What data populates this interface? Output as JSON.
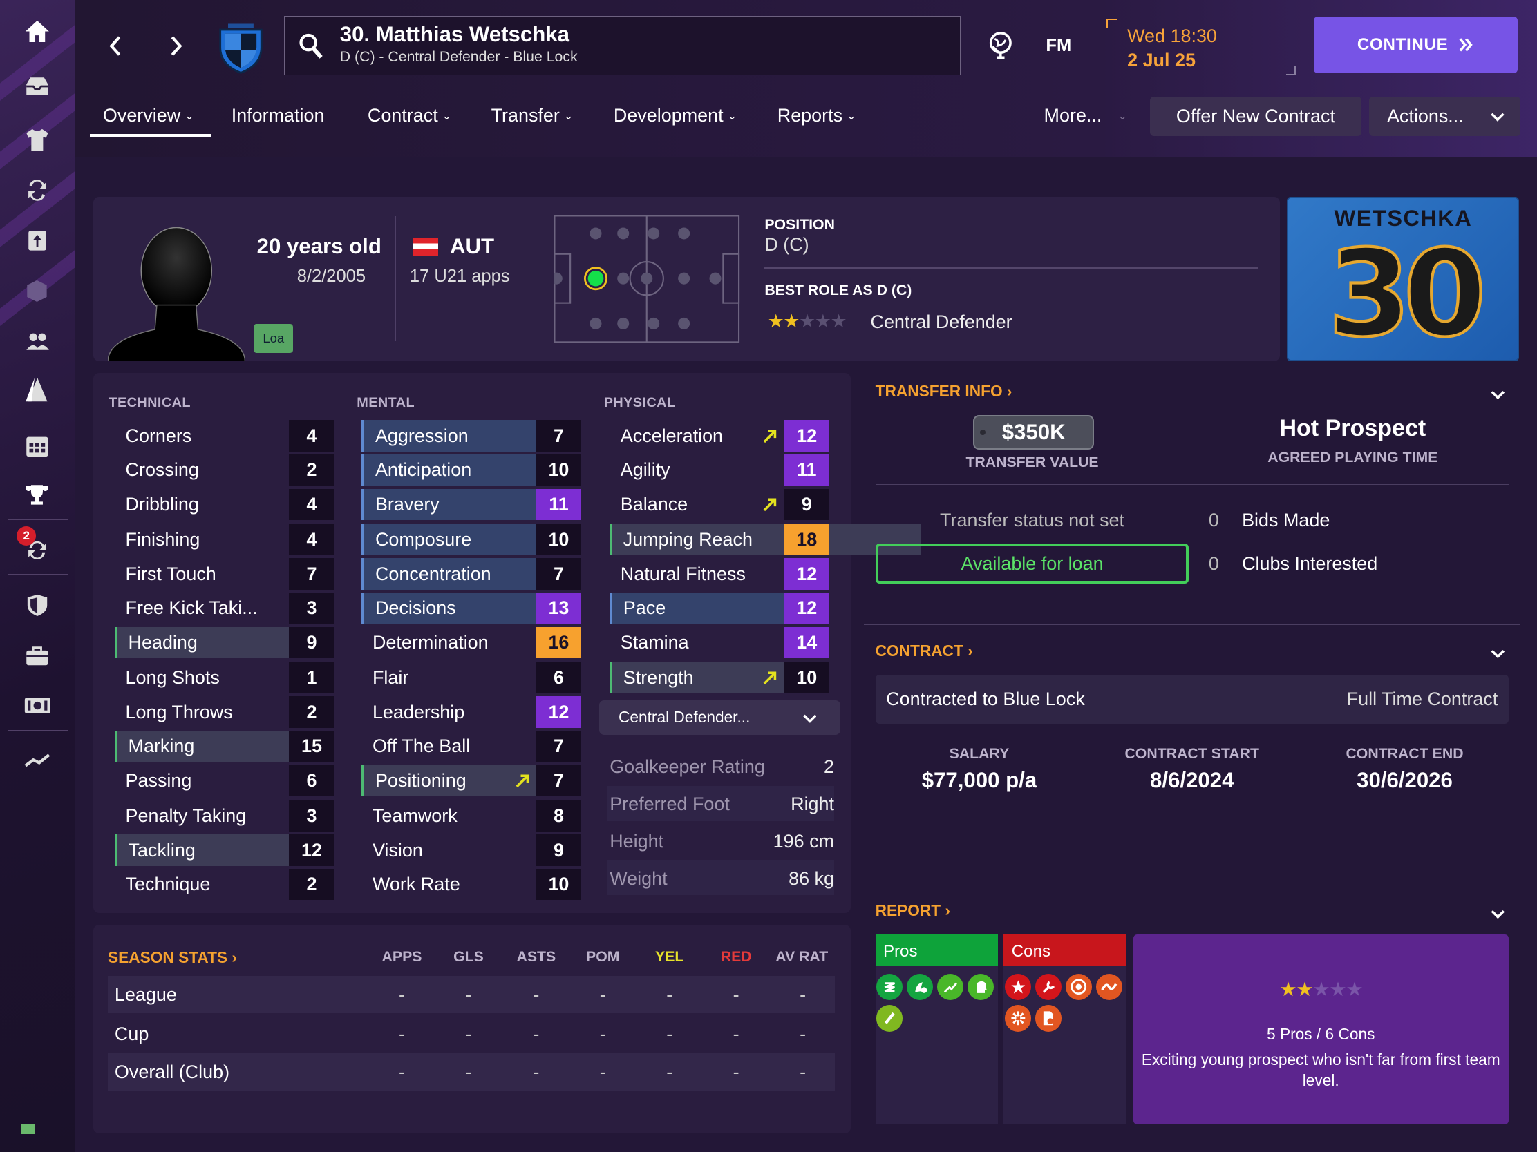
{
  "header": {
    "player_title": "30. Matthias Wetschka",
    "player_subtitle": "D (C) - Central Defender - Blue Lock",
    "fm_logo": "FM",
    "time": "Wed 18:30",
    "date": "2 Jul 25",
    "continue_label": "CONTINUE",
    "sidebar_notification": "2"
  },
  "tabs": [
    {
      "label": "Overview",
      "dropdown": true
    },
    {
      "label": "Information",
      "dropdown": false
    },
    {
      "label": "Contract",
      "dropdown": true
    },
    {
      "label": "Transfer",
      "dropdown": true
    },
    {
      "label": "Development",
      "dropdown": true
    },
    {
      "label": "Reports",
      "dropdown": true
    },
    {
      "label": "More...",
      "dropdown": true
    }
  ],
  "actions": {
    "offer": "Offer New Contract",
    "actions": "Actions..."
  },
  "profile": {
    "age": "20 years old",
    "dob": "8/2/2005",
    "nationality": "AUT",
    "u21": "17 U21 apps",
    "loan_badge": "Loa",
    "position_label": "POSITION",
    "position": "D (C)",
    "best_role_label": "BEST ROLE AS D (C)",
    "best_role": "Central Defender",
    "role_stars": 2,
    "shirt_name": "WETSCHKA",
    "shirt_number": "30"
  },
  "attributes": {
    "technical_label": "TECHNICAL",
    "mental_label": "MENTAL",
    "physical_label": "PHYSICAL",
    "technical": [
      {
        "name": "Corners",
        "value": "4"
      },
      {
        "name": "Crossing",
        "value": "2"
      },
      {
        "name": "Dribbling",
        "value": "4"
      },
      {
        "name": "Finishing",
        "value": "4"
      },
      {
        "name": "First Touch",
        "value": "7"
      },
      {
        "name": "Free Kick Taki...",
        "value": "3"
      },
      {
        "name": "Heading",
        "value": "9"
      },
      {
        "name": "Long Shots",
        "value": "1"
      },
      {
        "name": "Long Throws",
        "value": "2"
      },
      {
        "name": "Marking",
        "value": "15"
      },
      {
        "name": "Passing",
        "value": "6"
      },
      {
        "name": "Penalty Taking",
        "value": "3"
      },
      {
        "name": "Tackling",
        "value": "12"
      },
      {
        "name": "Technique",
        "value": "2"
      }
    ],
    "mental": [
      {
        "name": "Aggression",
        "value": "7"
      },
      {
        "name": "Anticipation",
        "value": "10"
      },
      {
        "name": "Bravery",
        "value": "11"
      },
      {
        "name": "Composure",
        "value": "10"
      },
      {
        "name": "Concentration",
        "value": "7"
      },
      {
        "name": "Decisions",
        "value": "13"
      },
      {
        "name": "Determination",
        "value": "16"
      },
      {
        "name": "Flair",
        "value": "6"
      },
      {
        "name": "Leadership",
        "value": "12"
      },
      {
        "name": "Off The Ball",
        "value": "7"
      },
      {
        "name": "Positioning",
        "value": "7"
      },
      {
        "name": "Teamwork",
        "value": "8"
      },
      {
        "name": "Vision",
        "value": "9"
      },
      {
        "name": "Work Rate",
        "value": "10"
      }
    ],
    "physical": [
      {
        "name": "Acceleration",
        "value": "12"
      },
      {
        "name": "Agility",
        "value": "11"
      },
      {
        "name": "Balance",
        "value": "9"
      },
      {
        "name": "Jumping Reach",
        "value": "18"
      },
      {
        "name": "Natural Fitness",
        "value": "12"
      },
      {
        "name": "Pace",
        "value": "12"
      },
      {
        "name": "Stamina",
        "value": "14"
      },
      {
        "name": "Strength",
        "value": "10"
      }
    ],
    "role_dropdown": "Central Defender...",
    "details": [
      {
        "key": "Goalkeeper Rating",
        "value": "2"
      },
      {
        "key": "Preferred Foot",
        "value": "Right"
      },
      {
        "key": "Height",
        "value": "196 cm"
      },
      {
        "key": "Weight",
        "value": "86 kg"
      }
    ]
  },
  "transfer": {
    "title": "TRANSFER INFO",
    "value": "$350K",
    "value_label": "TRANSFER VALUE",
    "prospect": "Hot Prospect",
    "prospect_label": "AGREED PLAYING TIME",
    "status": "Transfer status not set",
    "loan": "Available for loan",
    "bids_count": "0",
    "bids_label": "Bids Made",
    "clubs_count": "0",
    "clubs_label": "Clubs Interested"
  },
  "contract": {
    "title": "CONTRACT",
    "club": "Contracted to Blue Lock",
    "type": "Full Time Contract",
    "salary_label": "SALARY",
    "salary": "$77,000 p/a",
    "start_label": "CONTRACT START",
    "start": "8/6/2024",
    "end_label": "CONTRACT END",
    "end": "30/6/2026"
  },
  "season": {
    "title": "SEASON STATS",
    "columns": [
      "APPS",
      "GLS",
      "ASTS",
      "POM",
      "YEL",
      "RED",
      "AV RAT"
    ],
    "rows": [
      {
        "label": "League",
        "values": [
          "-",
          "-",
          "-",
          "-",
          "-",
          "-",
          "-"
        ]
      },
      {
        "label": "Cup",
        "values": [
          "-",
          "-",
          "-",
          "-",
          "-",
          "-",
          "-"
        ]
      },
      {
        "label": "Overall (Club)",
        "values": [
          "-",
          "-",
          "-",
          "-",
          "-",
          "-",
          "-"
        ]
      }
    ]
  },
  "report": {
    "title": "REPORT",
    "pros_label": "Pros",
    "cons_label": "Cons",
    "stars": 2,
    "summary": "5 Pros / 6 Cons",
    "description": "Exciting young prospect who isn't far from first team level."
  },
  "colors": {
    "accent": "#7754e6",
    "orange": "#f5a230",
    "green": "#43ce5a",
    "purple_val": "#7d2ed3",
    "gold_val": "#f7a12e"
  }
}
